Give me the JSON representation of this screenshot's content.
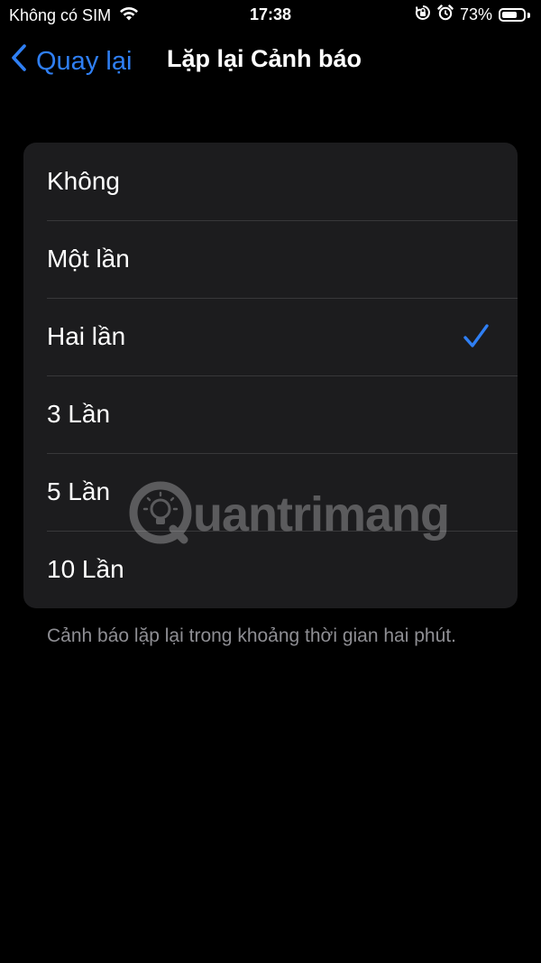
{
  "status_bar": {
    "carrier": "Không có SIM",
    "time": "17:38",
    "battery_percent_label": "73%",
    "battery_level": 0.73,
    "icons": [
      "wifi-icon",
      "orientation-lock-icon",
      "alarm-icon",
      "battery-icon"
    ]
  },
  "nav": {
    "back_label": "Quay lại",
    "title": "Lặp lại Cảnh báo"
  },
  "options": [
    {
      "label": "Không",
      "selected": false
    },
    {
      "label": "Một lần",
      "selected": false
    },
    {
      "label": "Hai lần",
      "selected": true
    },
    {
      "label": "3 Lần",
      "selected": false
    },
    {
      "label": "5 Lần",
      "selected": false
    },
    {
      "label": "10 Lần",
      "selected": false
    }
  ],
  "footer": {
    "note": "Cảnh báo lặp lại trong khoảng thời gian hai phút."
  },
  "watermark": {
    "text": "uantrimang"
  },
  "colors": {
    "background": "#000000",
    "cell_background": "#1c1c1e",
    "accent": "#2f7ff4",
    "separator": "#38383a",
    "secondary_text": "#8e8e93"
  }
}
